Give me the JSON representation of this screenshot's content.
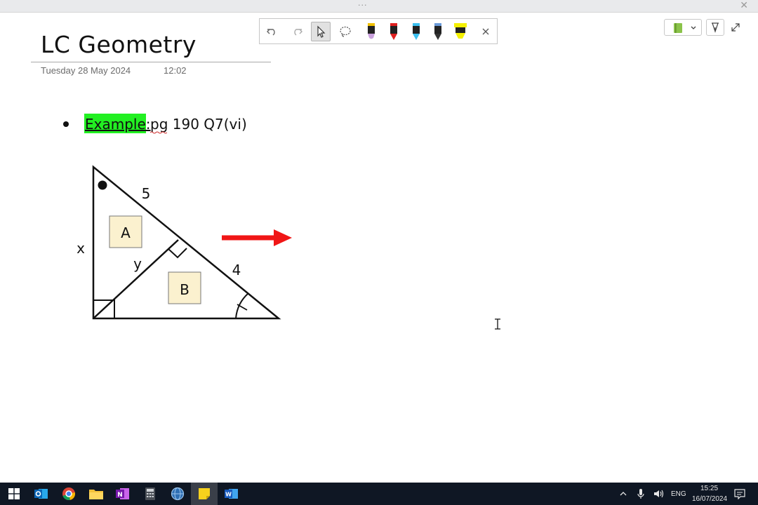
{
  "window": {
    "grip": "···"
  },
  "page": {
    "title": "LC Geometry",
    "date": "Tuesday 28 May 2024",
    "time": "12:02"
  },
  "content": {
    "example_label": "Example:",
    "question_text": "pg 190 Q7(vi)",
    "highlight_color": "#22f022"
  },
  "diagram": {
    "label_hypotenuse_upper": "5",
    "label_hypotenuse_lower": "4",
    "label_left_side": "x",
    "label_altitude": "y",
    "box_a": "A",
    "box_b": "B",
    "box_fill": "#fbf1cf",
    "arrow_color": "#f01616"
  },
  "toolbar": {
    "tools": [
      "undo-icon",
      "redo-icon",
      "select-icon",
      "lasso-icon",
      "pen-black-purple",
      "pen-red",
      "pen-cyan",
      "pen-black",
      "highlighter-yellow",
      "close-icon"
    ],
    "pen_colors": {
      "purple": "#c9a0dc",
      "red": "#e02020",
      "cyan": "#3cc0f0",
      "black": "#222222",
      "yellow": "#f4f000"
    }
  },
  "taskbar": {
    "language": "ENG",
    "clock_time": "15:25",
    "clock_date": "16/07/2024"
  }
}
